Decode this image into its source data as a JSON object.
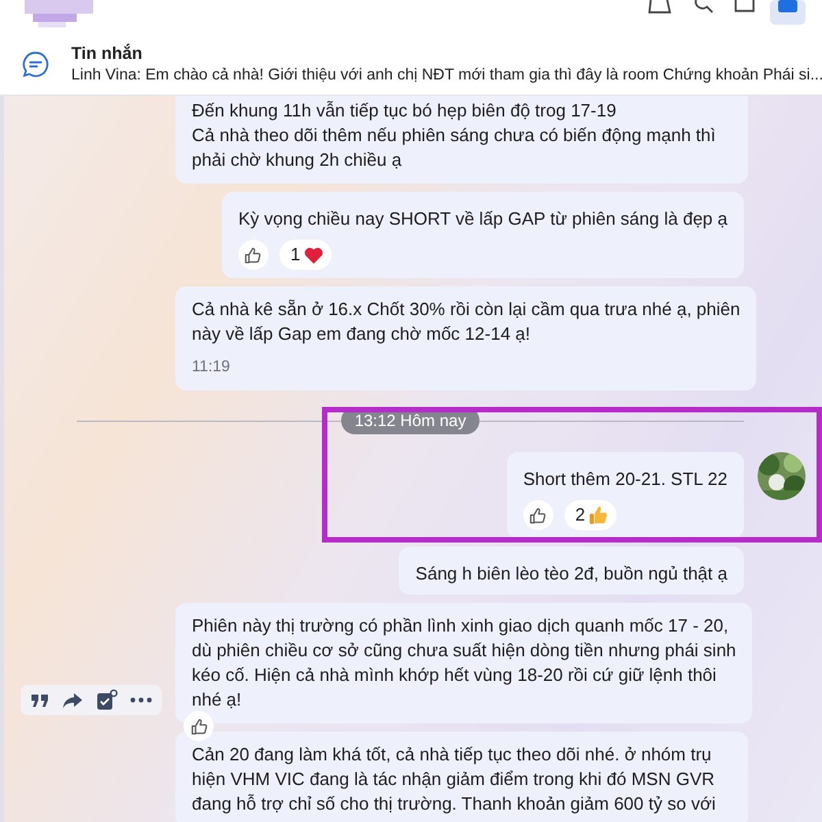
{
  "pinned": {
    "title": "Tin nhắn",
    "preview": "Linh Vina: Em chào cả nhà! Giới thiệu với anh chị NĐT mới tham gia thì đây là room Chứng khoản Phái si..."
  },
  "messages": [
    {
      "kind": "incoming",
      "text": "Đến khung 11h vẫn tiếp tục bó hẹp biên độ trog 17-19\nCả nhà theo dõi thêm nếu phiên sáng chưa có biến động mạnh thì\nphải chờ khung 2h chiều ạ"
    },
    {
      "kind": "outgoing",
      "text": "Kỳ vọng chiều nay SHORT về lấp GAP từ phiên sáng là đẹp ạ",
      "reactions": [
        {
          "kind": "heart",
          "count": "1"
        }
      ]
    },
    {
      "kind": "incoming",
      "text": "Cả nhà kê sẵn ở 16.x Chốt 30% rồi còn lại cầm qua trưa nhé ạ, phiên\nnày về lấp Gap em đang chờ mốc 12-14 ạ!",
      "time": "11:19"
    },
    {
      "kind": "divider",
      "text": "13:12 Hôm nay"
    },
    {
      "kind": "own",
      "text": "Short thêm 20-21. STL 22",
      "reactions": [
        {
          "kind": "thumb",
          "count": "2"
        }
      ],
      "highlighted": true
    },
    {
      "kind": "outgoing",
      "text": "Sáng h biên lèo tèo 2đ, buồn ngủ thật ạ"
    },
    {
      "kind": "incoming",
      "text": "Phiên này thị trường có phần lình xinh giao dịch quanh mốc 17 - 20,\ndù phiên chiều cơ sở cũng chưa suất hiện dòng tiền nhưng phái sinh\nkéo cố. Hiện cả nhà mình khớp hết vùng 18-20 rồi cứ giữ lệnh thôi\nnhé ạ!",
      "hovered": true,
      "like_button": true
    },
    {
      "kind": "incoming",
      "text": "Cản 20 đang làm khá tốt, cả nhà tiếp tục theo dõi nhé. ở nhóm trụ\nhiện VHM VIC đang là tác nhận giảm điểm trong khi đó MSN GVR\nđang hỗ trợ chỉ số cho thị trường. Thanh khoản giảm 600 tỷ so với"
    }
  ]
}
